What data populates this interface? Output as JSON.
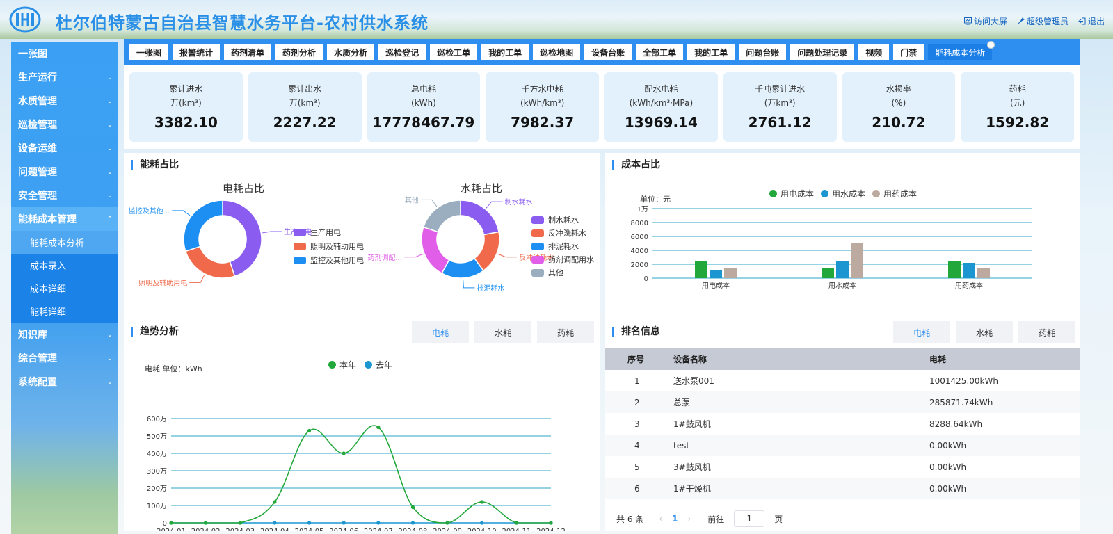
{
  "header": {
    "title": "杜尔伯特蒙古自治县智慧水务平台-农村供水系统",
    "links": [
      {
        "icon": "screen-icon",
        "label": "访问大屏"
      },
      {
        "icon": "user-icon",
        "label": "超级管理员"
      },
      {
        "icon": "logout-icon",
        "label": "退出"
      }
    ]
  },
  "sidebar": {
    "items": [
      {
        "label": "一张图",
        "chevron": false
      },
      {
        "label": "生产运行",
        "chevron": true
      },
      {
        "label": "水质管理",
        "chevron": true
      },
      {
        "label": "巡检管理",
        "chevron": true
      },
      {
        "label": "设备运维",
        "chevron": true
      },
      {
        "label": "问题管理",
        "chevron": true
      },
      {
        "label": "安全管理",
        "chevron": true
      },
      {
        "label": "能耗成本管理",
        "chevron": true,
        "open": true
      }
    ],
    "sub_items": [
      {
        "label": "能耗成本分析",
        "active": true
      },
      {
        "label": "成本录入"
      },
      {
        "label": "成本详细"
      },
      {
        "label": "能耗详细"
      }
    ],
    "items_after": [
      {
        "label": "知识库"
      },
      {
        "label": "综合管理"
      },
      {
        "label": "系统配置"
      }
    ]
  },
  "tabs": [
    "一张图",
    "报警统计",
    "药剂清单",
    "药剂分析",
    "水质分析",
    "巡检登记",
    "巡检工单",
    "我的工单",
    "巡检地图",
    "设备台账",
    "全部工单",
    "我的工单",
    "问题台账",
    "问题处理记录",
    "视频",
    "门禁",
    "能耗成本分析"
  ],
  "active_tab": 16,
  "stats": [
    {
      "label": "累计进水",
      "unit": "万(km³)",
      "value": "3382.10"
    },
    {
      "label": "累计出水",
      "unit": "万(km³)",
      "value": "2227.22"
    },
    {
      "label": "总电耗",
      "unit": "(kWh)",
      "value": "17778467.79"
    },
    {
      "label": "千方水电耗",
      "unit": "(kWh/km³)",
      "value": "7982.37"
    },
    {
      "label": "配水电耗",
      "unit": "(kWh/km³·MPa)",
      "value": "13969.14"
    },
    {
      "label": "千吨累计进水",
      "unit": "(万km³)",
      "value": "2761.12"
    },
    {
      "label": "水损率",
      "unit": "(%)",
      "value": "210.72"
    },
    {
      "label": "药耗",
      "unit": "(元)",
      "value": "1592.82"
    }
  ],
  "energy_panel": {
    "title": "能耗占比"
  },
  "cost_panel": {
    "title": "成本占比"
  },
  "trend_panel": {
    "title": "趋势分析",
    "buttons": [
      "电耗",
      "水耗",
      "药耗"
    ],
    "active_button": 0
  },
  "rank_panel": {
    "title": "排名信息",
    "buttons": [
      "电耗",
      "水耗",
      "药耗"
    ],
    "active_button": 0,
    "columns": [
      "序号",
      "设备名称",
      "电耗"
    ],
    "rows": [
      [
        "1",
        "送水泵001",
        "1001425.00kWh"
      ],
      [
        "2",
        "总泵",
        "285871.74kWh"
      ],
      [
        "3",
        "1#鼓风机",
        "8288.64kWh"
      ],
      [
        "4",
        "test",
        "0.00kWh"
      ],
      [
        "5",
        "3#鼓风机",
        "0.00kWh"
      ],
      [
        "6",
        "1#干燥机",
        "0.00kWh"
      ]
    ],
    "pager": {
      "total": "共 6 条",
      "prev": "‹",
      "page": "1",
      "next": "›",
      "goto": "前往",
      "input": "1",
      "suffix": "页"
    }
  },
  "chart_data": [
    {
      "type": "pie",
      "title": "电耗占比",
      "categories": [
        "生产用电",
        "照明及辅助用电",
        "监控及其他用电"
      ],
      "values": [
        45,
        25,
        30
      ],
      "callouts": [
        "生产用电",
        "照明及辅助用电",
        "监控及其他..."
      ],
      "colors": [
        "#8a5cf0",
        "#f0694a",
        "#1d8ff2"
      ]
    },
    {
      "type": "pie",
      "title": "水耗占比",
      "categories": [
        "制水耗水",
        "反冲洗耗水",
        "排泥耗水",
        "药剂调配用水",
        "其他"
      ],
      "values": [
        22,
        18,
        18,
        22,
        20
      ],
      "callouts": [
        "制水耗水",
        "反冲洗耗水",
        "排泥耗水",
        "药剂调配...",
        "其他"
      ],
      "colors": [
        "#8a5cf0",
        "#f0694a",
        "#1d8ff2",
        "#e05ee8",
        "#9aaebf"
      ]
    },
    {
      "type": "bar",
      "ylabel": "单位：元",
      "categories": [
        "用电成本",
        "用水成本",
        "用药成本"
      ],
      "series": [
        {
          "name": "用电成本",
          "color": "#22a83a",
          "values": [
            2400,
            1500,
            2400
          ]
        },
        {
          "name": "用水成本",
          "color": "#1b96d0",
          "values": [
            1200,
            2400,
            2200
          ]
        },
        {
          "name": "用药成本",
          "color": "#bca9a0",
          "values": [
            1400,
            5000,
            1500
          ]
        }
      ],
      "ylim": [
        0,
        10000
      ],
      "yticks": [
        "0",
        "2000",
        "4000",
        "6000",
        "8000",
        "1万"
      ],
      "legend": "top-center"
    },
    {
      "type": "line",
      "ylabel": "电耗 单位：kWh",
      "categories": [
        "2024-01",
        "2024-02",
        "2024-03",
        "2024-04",
        "2024-05",
        "2024-06",
        "2024-07",
        "2024-08",
        "2024-09",
        "2024-10",
        "2024-11",
        "2024-12"
      ],
      "series": [
        {
          "name": "本年",
          "color": "#22a83a",
          "values": [
            0,
            0,
            0,
            1200000,
            5300000,
            4000000,
            5500000,
            900000,
            0,
            1200000,
            0,
            0
          ]
        },
        {
          "name": "去年",
          "color": "#1b96d0",
          "values": [
            0,
            0,
            0,
            0,
            0,
            0,
            0,
            0,
            0,
            0,
            0,
            0
          ]
        }
      ],
      "ylim": [
        0,
        6000000
      ],
      "yticks": [
        "0",
        "100万",
        "200万",
        "300万",
        "400万",
        "500万",
        "600万"
      ],
      "legend": "top-center"
    }
  ]
}
